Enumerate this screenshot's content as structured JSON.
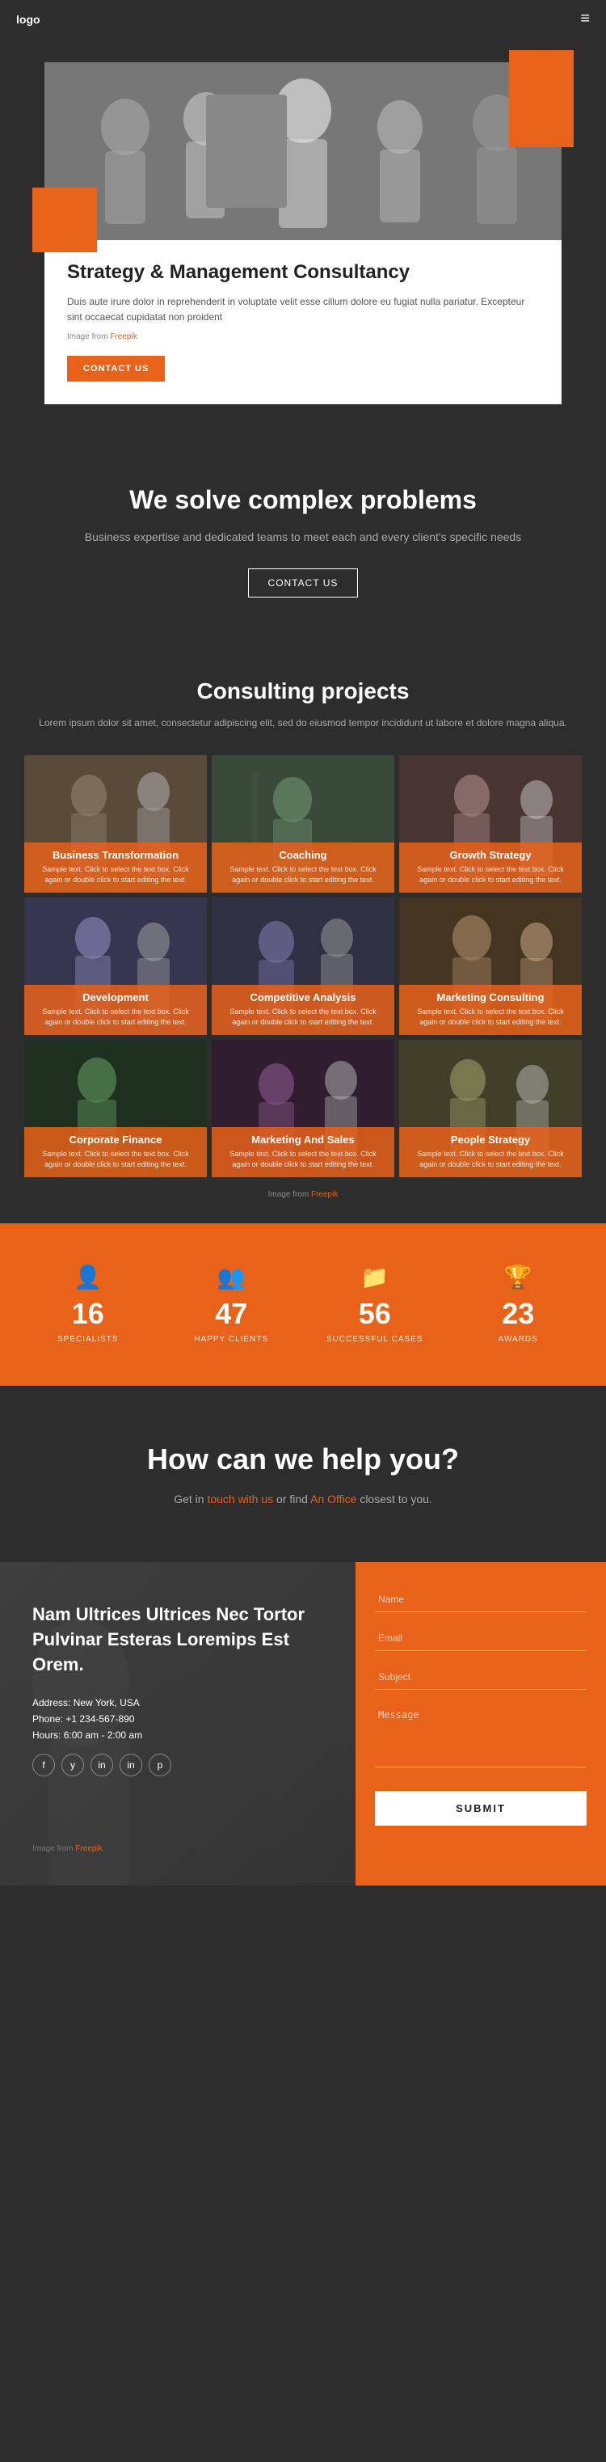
{
  "nav": {
    "logo": "logo",
    "menu_icon": "≡"
  },
  "hero": {
    "title": "Strategy & Management Consultancy",
    "description": "Duis aute irure dolor in reprehenderit in voluptate velit esse cillum dolore eu fugiat nulla pariatur. Excepteur sint occaecat cupidatat non proident",
    "image_credit_text": "Image from",
    "image_credit_link": "Freepik",
    "contact_btn": "CONTACT US"
  },
  "solve": {
    "title": "We solve complex problems",
    "description": "Business expertise and dedicated teams to meet each and every client's specific needs",
    "contact_btn": "CONTACT US"
  },
  "projects": {
    "title": "Consulting projects",
    "subtitle": "Lorem ipsum dolor sit amet, consectetur adipiscing elit, sed do eiusmod tempor incididunt ut labore et dolore magna aliqua.",
    "image_credit_text": "Image from",
    "image_credit_link": "Freepik",
    "items": [
      {
        "title": "Business Transformation",
        "desc": "Sample text. Click to select the text box. Click again or double click to start editing the text."
      },
      {
        "title": "Coaching",
        "desc": "Sample text. Click to select the text box. Click again or double click to start editing the text."
      },
      {
        "title": "Growth Strategy",
        "desc": "Sample text. Click to select the text box. Click again or double click to start editing the text."
      },
      {
        "title": "Development",
        "desc": "Sample text. Click to select the text box. Click again or double click to start editing the text."
      },
      {
        "title": "Competitive Analysis",
        "desc": "Sample text. Click to select the text box. Click again or double click to start editing the text."
      },
      {
        "title": "Marketing Consulting",
        "desc": "Sample text. Click to select the text box. Click again or double click to start editing the text."
      },
      {
        "title": "Corporate Finance",
        "desc": "Sample text. Click to select the text box. Click again or double click to start editing the text."
      },
      {
        "title": "Marketing And Sales",
        "desc": "Sample text. Click to select the text box. Click again or double click to start editing the text."
      },
      {
        "title": "People Strategy",
        "desc": "Sample text. Click to select the text box. Click again or double click to start editing the text."
      }
    ]
  },
  "stats": [
    {
      "icon": "👤",
      "number": "16",
      "label": "SPECIALISTS"
    },
    {
      "icon": "👥",
      "number": "47",
      "label": "HAPPY CLIENTS"
    },
    {
      "icon": "📁",
      "number": "56",
      "label": "SUCCESSFUL CASES"
    },
    {
      "icon": "🏆",
      "number": "23",
      "label": "AWARDS"
    }
  ],
  "help": {
    "title": "How can we help you?",
    "text_before": "Get in",
    "link1": "touch with us",
    "text_middle": "or find",
    "link2": "An Office",
    "text_after": "closest to you."
  },
  "contact": {
    "tagline": "Nam Ultrices Ultrices Nec Tortor Pulvinar Esteras Loremips Est Orem.",
    "address_label": "Address:",
    "address_value": "New York, USA",
    "phone_label": "Phone:",
    "phone_value": "+1 234-567-890",
    "hours_label": "Hours:",
    "hours_value": "6:00 am - 2:00 am",
    "image_credit_text": "Image from",
    "image_credit_link": "Freepik",
    "social": [
      "f",
      "y",
      "in",
      "in",
      "p"
    ],
    "form": {
      "name_placeholder": "Name",
      "email_placeholder": "Email",
      "subject_placeholder": "Subject",
      "message_placeholder": "Message",
      "submit_btn": "SUBMIT"
    }
  }
}
